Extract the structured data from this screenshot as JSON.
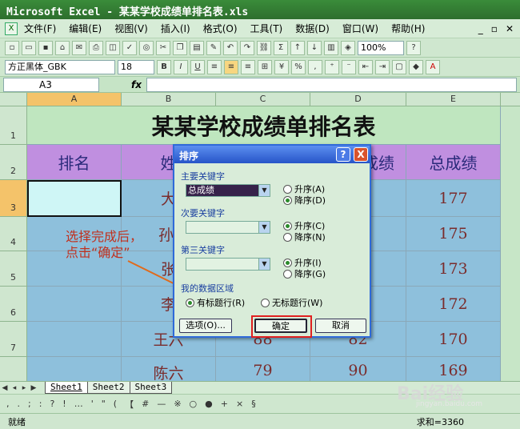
{
  "window": {
    "title": "Microsoft Excel - 某某学校成绩单排名表.xls"
  },
  "menu": {
    "items": [
      "文件(F)",
      "编辑(E)",
      "视图(V)",
      "插入(I)",
      "格式(O)",
      "工具(T)",
      "数据(D)",
      "窗口(W)",
      "帮助(H)"
    ]
  },
  "toolbar": {
    "zoom": "100%",
    "font_name": "方正黑体_GBK",
    "font_size": "18"
  },
  "formula_bar": {
    "name_box": "A3",
    "fx": "fx"
  },
  "columns": [
    "A",
    "B",
    "C",
    "D",
    "E"
  ],
  "rows": [
    "1",
    "2",
    "3",
    "4",
    "5",
    "6",
    "7"
  ],
  "sheet": {
    "title": "某某学校成绩单排名表",
    "headers": [
      "排名",
      "姓",
      "",
      "成绩",
      "总成绩"
    ],
    "data_rows": [
      [
        "",
        "大",
        "",
        "",
        "177"
      ],
      [
        "",
        "孙",
        "",
        "",
        "175"
      ],
      [
        "",
        "张",
        "",
        "",
        "173"
      ],
      [
        "",
        "李",
        "",
        "",
        "172"
      ],
      [
        "",
        "王六",
        "88",
        "82",
        "170"
      ],
      [
        "",
        "陈六",
        "79",
        "90",
        "169"
      ]
    ]
  },
  "sheet_tabs": [
    "Sheet1",
    "Sheet2",
    "Sheet3"
  ],
  "status": {
    "ready": "就绪",
    "sum": "求和=3360"
  },
  "dialog": {
    "title": "排序",
    "help": "?",
    "close": "X",
    "primary_key_label": "主要关键字",
    "primary_key_value": "总成绩",
    "asc1": "升序(A)",
    "desc1": "降序(D)",
    "secondary_key_label": "次要关键字",
    "asc2": "升序(C)",
    "desc2": "降序(N)",
    "third_key_label": "第三关键字",
    "asc3": "升序(I)",
    "desc3": "降序(G)",
    "range_label": "我的数据区域",
    "has_header": "有标题行(R)",
    "no_header": "无标题行(W)",
    "options_button": "选项(O)...",
    "ok_button": "确定",
    "cancel_button": "取消"
  },
  "annotation": {
    "line1": "选择完成后，",
    "line2": "点击“确定”"
  },
  "watermark": {
    "text": "Bai经验",
    "url": "jingyan.baidu.com"
  },
  "colors": {
    "header_purple": "#c08fe0",
    "data_blue": "#8ec0dc",
    "highlight_red": "#e02020",
    "annotation": "#c0311f"
  }
}
